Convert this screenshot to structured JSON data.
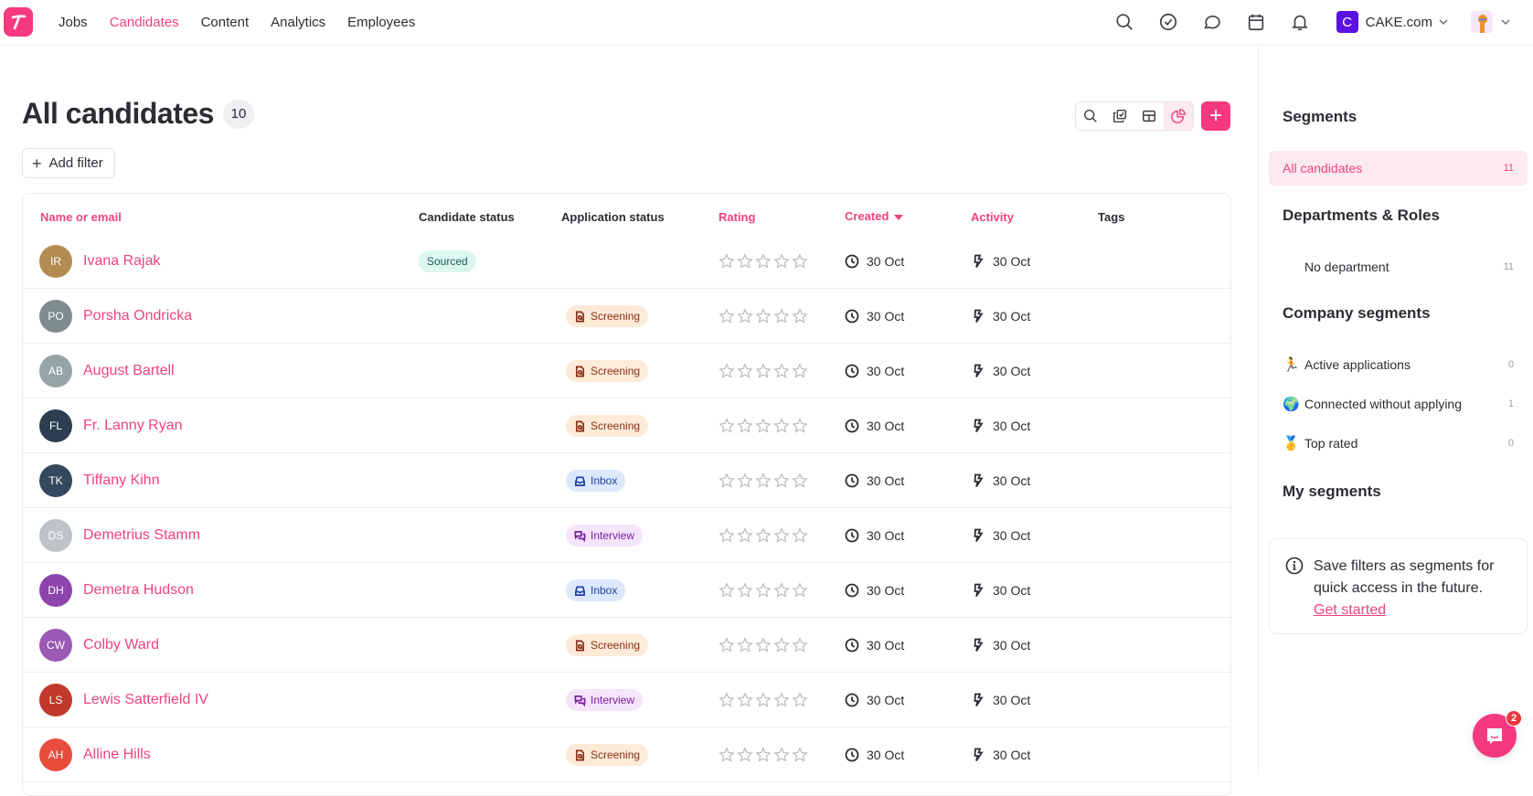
{
  "nav": {
    "items": [
      {
        "label": "Jobs",
        "active": false
      },
      {
        "label": "Candidates",
        "active": true
      },
      {
        "label": "Content",
        "active": false
      },
      {
        "label": "Analytics",
        "active": false
      },
      {
        "label": "Employees",
        "active": false
      }
    ],
    "icons": [
      "search-icon",
      "check-circle-icon",
      "chat-bubble-icon",
      "calendar-icon",
      "bell-icon"
    ],
    "company": {
      "initial": "C",
      "name": "CAKE.com",
      "color": "#5a12e0"
    }
  },
  "header": {
    "title": "All candidates",
    "count": "10",
    "add_filter_label": "Add filter",
    "add_button_label": "+"
  },
  "table": {
    "columns": {
      "name": "Name or email",
      "candidate_status": "Candidate status",
      "application_status": "Application status",
      "rating": "Rating",
      "created": "Created",
      "activity": "Activity",
      "tags": "Tags"
    },
    "rows": [
      {
        "initials": "IR",
        "name": "Ivana Rajak",
        "avatar_color": "#b38c52",
        "candidate_status": "Sourced",
        "application_status": "",
        "rating": 0,
        "created": "30 Oct",
        "activity": "30 Oct",
        "tags": ""
      },
      {
        "initials": "PO",
        "name": "Porsha Ondricka",
        "avatar_color": "#7f8c8d",
        "candidate_status": "",
        "application_status": "Screening",
        "rating": 0,
        "created": "30 Oct",
        "activity": "30 Oct",
        "tags": ""
      },
      {
        "initials": "AB",
        "name": "August Bartell",
        "avatar_color": "#95a5a6",
        "candidate_status": "",
        "application_status": "Screening",
        "rating": 0,
        "created": "30 Oct",
        "activity": "30 Oct",
        "tags": ""
      },
      {
        "initials": "FL",
        "name": "Fr. Lanny Ryan",
        "avatar_color": "#2c3e50",
        "candidate_status": "",
        "application_status": "Screening",
        "rating": 0,
        "created": "30 Oct",
        "activity": "30 Oct",
        "tags": ""
      },
      {
        "initials": "TK",
        "name": "Tiffany Kihn",
        "avatar_color": "#34495e",
        "candidate_status": "",
        "application_status": "Inbox",
        "rating": 0,
        "created": "30 Oct",
        "activity": "30 Oct",
        "tags": ""
      },
      {
        "initials": "DS",
        "name": "Demetrius Stamm",
        "avatar_color": "#bdc3c7",
        "candidate_status": "",
        "application_status": "Interview",
        "rating": 0,
        "created": "30 Oct",
        "activity": "30 Oct",
        "tags": ""
      },
      {
        "initials": "DH",
        "name": "Demetra Hudson",
        "avatar_color": "#8e44ad",
        "candidate_status": "",
        "application_status": "Inbox",
        "rating": 0,
        "created": "30 Oct",
        "activity": "30 Oct",
        "tags": ""
      },
      {
        "initials": "CW",
        "name": "Colby Ward",
        "avatar_color": "#9b59b6",
        "candidate_status": "",
        "application_status": "Screening",
        "rating": 0,
        "created": "30 Oct",
        "activity": "30 Oct",
        "tags": ""
      },
      {
        "initials": "LS",
        "name": "Lewis Satterfield IV",
        "avatar_color": "#c0392b",
        "candidate_status": "",
        "application_status": "Interview",
        "rating": 0,
        "created": "30 Oct",
        "activity": "30 Oct",
        "tags": ""
      },
      {
        "initials": "AH",
        "name": "Alline Hills",
        "avatar_color": "#e74c3c",
        "candidate_status": "",
        "application_status": "Screening",
        "rating": 0,
        "created": "30 Oct",
        "activity": "30 Oct",
        "tags": ""
      }
    ]
  },
  "segments": {
    "title": "Segments",
    "all": {
      "label": "All candidates",
      "count": "11"
    },
    "departments_title": "Departments & Roles",
    "departments": [
      {
        "label": "No department",
        "count": "11"
      }
    ],
    "company_title": "Company segments",
    "company": [
      {
        "emoji": "🏃",
        "label": "Active applications",
        "count": "0"
      },
      {
        "emoji": "🌍",
        "label": "Connected without applying",
        "count": "1"
      },
      {
        "emoji": "🥇",
        "label": "Top rated",
        "count": "0"
      }
    ],
    "my_title": "My segments",
    "info_text": "Save filters as segments for quick access in the future.",
    "info_link": "Get started"
  },
  "chat": {
    "badge": "2"
  },
  "colors": {
    "accent": "#f5397f",
    "accent_text": "#f0437f"
  }
}
